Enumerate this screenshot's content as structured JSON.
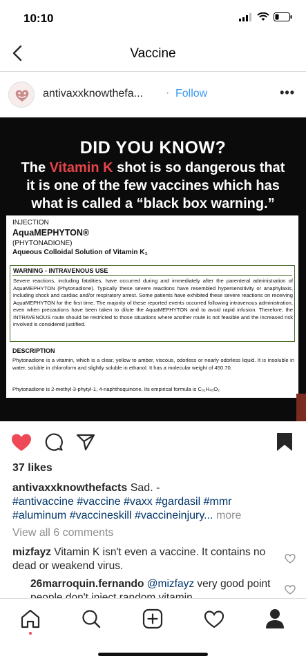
{
  "status_bar": {
    "time": "10:10"
  },
  "nav": {
    "title": "Vaccine",
    "back_icon": "chevron-left-icon"
  },
  "post": {
    "username": "antivaxxknowthefa...",
    "separator": "·",
    "follow_label": "Follow",
    "more_label": "•••",
    "image": {
      "headline": "DID YOU KNOW?",
      "line1_pre": "The ",
      "line1_highlight": "Vitamin K",
      "line1_post": " shot is so dangerous that",
      "line2": "it is one of the few vaccines which has",
      "line3": "what is called a “black box warning.”",
      "label": {
        "injection": "INJECTION",
        "brand": "AquaMEPHYTON®",
        "generic": "(PHYTONADIONE)",
        "solution": "Aqueous Colloidal Solution of Vitamin K₁",
        "warning_title": "WARNING - INTRAVENOUS USE",
        "warning_text": "Severe reactions, including fatalities, have occurred during and immediately after the parenteral administration of AquaMEPHYTON (Phytonadione). Typically these severe reactions have resembled hypersensitivity or anaphylaxis, including shock and cardiac and/or respiratory arrest. Some patients have exhibited these severe reactions on receiving AquaMEPHYTON for the first time. The majority of these reported events occurred following intravenous administration, even when precautions have been taken to dilute the AquaMEPHYTON and to avoid rapid infusion. Therefore, the INTRAVENOUS route should be restricted to those situations where another route is not feasible and the increased risk involved is considered justified.",
        "description_title": "DESCRIPTION",
        "description_text": "Phytonadione is a vitamin, which is a clear, yellow to amber, viscous, odorless or nearly odorless liquid. It is insoluble in water, soluble in chloroform and slightly soluble in ethanol. It has a molecular weight of 450.70.",
        "formula_text": "Phytonadione is 2-methyl-3-phytyl-1, 4-naphthoquinone. Its empirical formula is C₃₁H₄₆O₂"
      }
    },
    "likes": "37 likes",
    "caption": {
      "username": "antivaxxknowthefacts",
      "text": " Sad. -",
      "tags_line1": "#antivaccine #vaccine #vaxx #gardasil #mmr",
      "tags_line2": "#aluminum #vaccineskill #vaccineinjury...",
      "more": " more"
    },
    "view_comments": "View all 6 comments",
    "comments": [
      {
        "username": "mizfayz",
        "text": " Vitamin K isn't even a vaccine. It contains no dead or weakend virus."
      },
      {
        "username": "26marroquin.fernando",
        "mention": " @mizfayz",
        "text": " very good point people don't inject random vitamin"
      }
    ]
  },
  "colors": {
    "like": "#ed4956",
    "link": "#3897f0",
    "vitamin_k": "#e8444a"
  }
}
